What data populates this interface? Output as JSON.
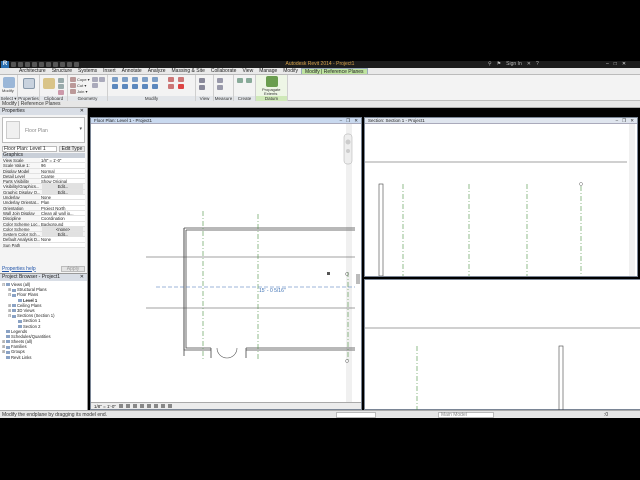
{
  "app": {
    "logo": "R",
    "title": "Autodesk Revit 2014 -    Project1",
    "signin": "Sign In",
    "help": "?"
  },
  "tabs": [
    "Architecture",
    "Structure",
    "Systems",
    "Insert",
    "Annotate",
    "Analyze",
    "Massing & Site",
    "Collaborate",
    "View",
    "Manage",
    "Modify",
    "Modify | Reference Planes"
  ],
  "ribbon": {
    "select": {
      "label": "Select ▾",
      "big": "Modify"
    },
    "properties": {
      "label": "Properties"
    },
    "clipboard": {
      "label": "Clipboard"
    },
    "geometry": {
      "label": "Geometry",
      "cope": "Cope ▾",
      "cut": "Cut ▾",
      "join": "Join ▾"
    },
    "modify": {
      "label": "Modify"
    },
    "view": {
      "label": "View"
    },
    "measure": {
      "label": "Measure"
    },
    "create": {
      "label": "Create"
    },
    "datum": {
      "label": "Datum",
      "big1": "Propagate",
      "big2": "Extents"
    }
  },
  "options_bar": {
    "text": "Modify | Reference Planes"
  },
  "properties": {
    "header": "Properties",
    "close": "✕",
    "type_name": "Floor Plan",
    "instance": "Floor Plan: Level 1",
    "edit_type": "Edit Type",
    "category": "Graphics",
    "rows": [
      {
        "k": "View Scale",
        "v": "1/8\" = 1'-0\""
      },
      {
        "k": "Scale Value 1:",
        "v": "96"
      },
      {
        "k": "Display Model",
        "v": "Normal"
      },
      {
        "k": "Detail Level",
        "v": "Coarse"
      },
      {
        "k": "Parts Visibility",
        "v": "Show Original"
      },
      {
        "k": "Visibility/Graphics...",
        "v": "Edit...",
        "btn": true
      },
      {
        "k": "Graphic Display O...",
        "v": "Edit...",
        "btn": true
      },
      {
        "k": "Underlay",
        "v": "None"
      },
      {
        "k": "Underlay Orientat...",
        "v": "Plan"
      },
      {
        "k": "Orientation",
        "v": "Project North"
      },
      {
        "k": "Wall Join Display",
        "v": "Clean all wall jo..."
      },
      {
        "k": "Discipline",
        "v": "Coordination"
      },
      {
        "k": "Color Scheme Loc...",
        "v": "Background"
      },
      {
        "k": "Color Scheme",
        "v": "<none>",
        "btn": true
      },
      {
        "k": "System Color Sch...",
        "v": "Edit...",
        "btn": true
      },
      {
        "k": "Default Analysis D...",
        "v": "None"
      },
      {
        "k": "Sun Path",
        "v": ""
      }
    ],
    "help_link": "Properties help",
    "apply": "Apply"
  },
  "browser": {
    "header": "Project Browser - Project1",
    "close": "✕",
    "items": [
      {
        "t": "Views (all)",
        "d": 0,
        "g": "⊟"
      },
      {
        "t": "Structural Plans",
        "d": 1,
        "g": "⊞"
      },
      {
        "t": "Floor Plans",
        "d": 1,
        "g": "⊟"
      },
      {
        "t": "Level 1",
        "d": 2,
        "g": "",
        "bold": true
      },
      {
        "t": "Ceiling Plans",
        "d": 1,
        "g": "⊞"
      },
      {
        "t": "3D Views",
        "d": 1,
        "g": "⊞"
      },
      {
        "t": "Sections (Section 1)",
        "d": 1,
        "g": "⊟"
      },
      {
        "t": "Section 1",
        "d": 2,
        "g": ""
      },
      {
        "t": "Section 2",
        "d": 2,
        "g": ""
      },
      {
        "t": "Legends",
        "d": 0,
        "g": ""
      },
      {
        "t": "Schedules/Quantities",
        "d": 0,
        "g": ""
      },
      {
        "t": "Sheets (all)",
        "d": 0,
        "g": "⊞"
      },
      {
        "t": "Families",
        "d": 0,
        "g": "⊞"
      },
      {
        "t": "Groups",
        "d": 0,
        "g": "⊞"
      },
      {
        "t": "Revit Links",
        "d": 0,
        "g": ""
      }
    ]
  },
  "views": {
    "floor": {
      "title": "Floor Plan: Level 1 - Project1",
      "scale": "1/8\" = 1'-0\"",
      "dim": "15' - 0 5/16\""
    },
    "section1": {
      "title": "Section: Section 1 - Project1"
    }
  },
  "status": {
    "text": "Modify the endplane by dragging its model end.",
    "model": "Main Model",
    "filter": ":0"
  }
}
